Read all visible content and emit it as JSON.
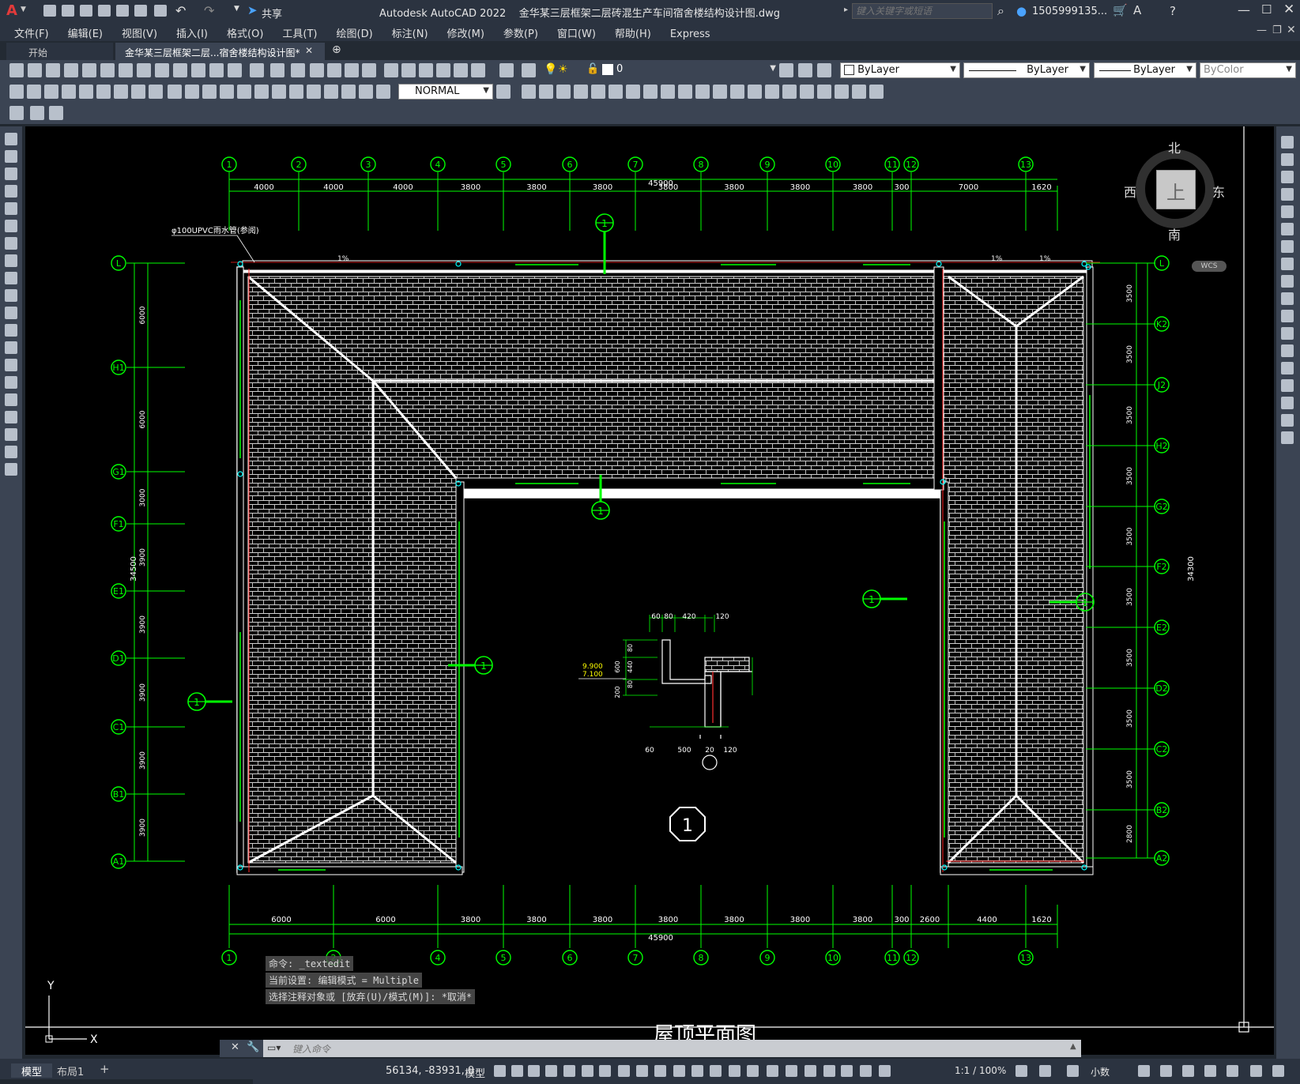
{
  "titlebar": {
    "app_logo": "A",
    "share_label": "共享",
    "title": "Autodesk AutoCAD 2022    金华某三层框架二层砖混生产车间宿舍楼结构设计图.dwg",
    "search_placeholder": "键入关键字或短语",
    "user": "1505999135...",
    "window_controls": [
      "minimize-icon",
      "restore-icon",
      "close-icon"
    ]
  },
  "menubar": {
    "items": [
      "文件(F)",
      "编辑(E)",
      "视图(V)",
      "插入(I)",
      "格式(O)",
      "工具(T)",
      "绘图(D)",
      "标注(N)",
      "修改(M)",
      "参数(P)",
      "窗口(W)",
      "帮助(H)",
      "Express"
    ]
  },
  "tabs": {
    "items": [
      {
        "label": "开始",
        "active": false
      },
      {
        "label": "金华某三层框架二层...宿舍楼结构设计图*",
        "active": true
      }
    ]
  },
  "toolbar": {
    "layer_value": "0",
    "color_value": "ByLayer",
    "linetype_value": "ByLayer",
    "lineweight_value": "ByLayer",
    "plotstyle_value": "ByColor",
    "dimstyle_value": "NORMAL"
  },
  "viewcube": {
    "north": "北",
    "south": "南",
    "east": "东",
    "west": "西",
    "top": "上",
    "wcs": "WCS"
  },
  "drawing": {
    "top_axes": [
      "1",
      "2",
      "3",
      "4",
      "5",
      "6",
      "7",
      "8",
      "9",
      "10",
      "11",
      "12",
      "13"
    ],
    "top_dims": [
      "4000",
      "4000",
      "4000",
      "3800",
      "3800",
      "3800",
      "3800",
      "3800",
      "3800",
      "3800",
      "300",
      "7000",
      "1620"
    ],
    "top_total": "45900",
    "bottom_dims": [
      "6000",
      "6000",
      "3800",
      "3800",
      "3800",
      "3800",
      "3800",
      "3800",
      "3800",
      "300",
      "2600",
      "4400",
      "1620"
    ],
    "bottom_total": "45900",
    "left_axes": [
      "L",
      "H1",
      "G1",
      "F1",
      "E1",
      "D1",
      "C1",
      "B1",
      "A1"
    ],
    "left_dims": [
      "6000",
      "6000",
      "3000",
      "3900",
      "3900",
      "3900",
      "3900",
      "3900"
    ],
    "left_total": "34500",
    "right_axes": [
      "L",
      "K2",
      "J2",
      "H2",
      "G2",
      "F2",
      "E2",
      "D2",
      "C2",
      "B2",
      "A2"
    ],
    "right_dims": [
      "3500",
      "3500",
      "3500",
      "3500",
      "3500",
      "3500",
      "3500",
      "3500",
      "3500",
      "2800"
    ],
    "right_total": "34300",
    "downpipe_note": "φ100UPVC雨水管(参阅)",
    "slope_labels": [
      "1%",
      "1%",
      "1%"
    ],
    "detail_dims_top": [
      "60",
      "80",
      "420",
      "120"
    ],
    "detail_dims_bottom": [
      "60",
      "500",
      "20",
      "120"
    ],
    "detail_dims_vert": [
      "80",
      "600",
      "440",
      "80",
      "200"
    ],
    "elev_1": "9.900",
    "elev_2": "7.100",
    "detail_marker": "1",
    "plan_title": "屋顶平面图"
  },
  "ucs": {
    "y": "Y",
    "x": "X"
  },
  "command": {
    "history": [
      "命令: _textedit",
      "当前设置: 编辑模式 = Multiple",
      "选择注释对象或 [放弃(U)/模式(M)]: *取消*"
    ],
    "placeholder": "键入命令"
  },
  "layouts": {
    "items": [
      "模型",
      "布局1"
    ],
    "add": "+"
  },
  "status": {
    "coords": "56134, -83931, 0",
    "model": "模型",
    "scale": "1:1 / 100%",
    "units": "小数"
  },
  "colors": {
    "canvas": "#000000",
    "green": "#00ff00",
    "white": "#ffffff",
    "red": "#ff0000",
    "cyan": "#00ffff",
    "ui_dark": "#2b3340",
    "ui_mid": "#3b4453"
  }
}
